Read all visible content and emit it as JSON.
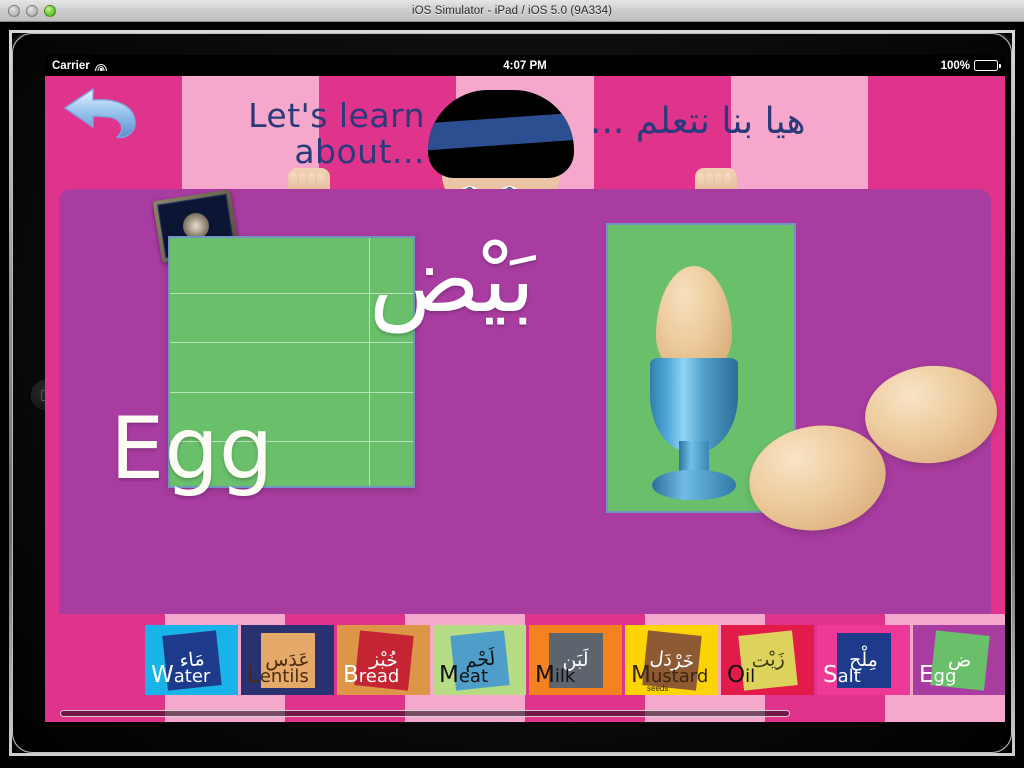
{
  "window": {
    "title": "iOS Simulator - iPad / iOS 5.0 (9A334)",
    "traffic_lights": [
      "close-disabled",
      "minimize-disabled",
      "zoom-green"
    ]
  },
  "status_bar": {
    "carrier": "Carrier",
    "wifi_icon": "wifi-icon",
    "time": "4:07 PM",
    "battery_percent": "100%",
    "battery_icon": "battery-full-icon"
  },
  "header": {
    "back_button_icon": "back-arrow-icon",
    "title_en_line1": "Let's learn",
    "title_en_line2": "about...",
    "title_ar": "هيا بنا نتعلم ...",
    "child_photo_alt": "child-with-beanie-photo",
    "stripe_colors": [
      "#e0338b",
      "#f5a8cc",
      "#e0338b",
      "#f5a8cc",
      "#e0338b",
      "#f5a8cc",
      "#e0338b"
    ]
  },
  "content": {
    "panel_color": "#a83ca0",
    "book_icon": "quran-book-icon",
    "card_bg": "#69bf6a",
    "card_border": "#7492c4",
    "word_arabic": "بَيْض",
    "word_english": "Egg",
    "picture_alt": "egg-in-blue-eggcup-photo"
  },
  "thumbnails": [
    {
      "english": "Water",
      "english_cap": "W",
      "english_rest": "ater",
      "arabic": "مَاء",
      "tile_bg": "#18b4e9",
      "note_bg": "#1e3a8a",
      "note_text": "#ffffff",
      "en_color": "#ffffff"
    },
    {
      "english": "Lentils",
      "english_cap": "L",
      "english_rest": "entils",
      "arabic": "عَدَس",
      "tile_bg": "#2a3170",
      "note_bg": "#e5a96a",
      "note_text": "#4a2b10",
      "en_color": "#4a2b10"
    },
    {
      "english": "Bread",
      "english_cap": "B",
      "english_rest": "read",
      "arabic": "خُبْز",
      "tile_bg": "#dd9548",
      "note_bg": "#c52432",
      "note_text": "#ffffff",
      "en_color": "#ffffff"
    },
    {
      "english": "Meat",
      "english_cap": "M",
      "english_rest": "eat",
      "arabic": "لَحْم",
      "tile_bg": "#b6dc85",
      "note_bg": "#4f9ec9",
      "note_text": "#111111",
      "en_color": "#111111"
    },
    {
      "english": "Milk",
      "english_cap": "M",
      "english_rest": "ilk",
      "arabic": "لَبَن",
      "tile_bg": "#f4821f",
      "note_bg": "#5c646e",
      "note_text": "#ffffff",
      "en_color": "#111111"
    },
    {
      "english": "Mustard",
      "english_cap": "M",
      "english_rest": "ustard",
      "sub": "seeds",
      "arabic": "خَرْدَل",
      "tile_bg": "#fcd406",
      "note_bg": "#8d5a33",
      "note_text": "#ffffff",
      "en_color": "#3a2410"
    },
    {
      "english": "Oil",
      "english_cap": "O",
      "english_rest": "il",
      "arabic": "زَيْت",
      "tile_bg": "#e31b4b",
      "note_bg": "#ddd35c",
      "note_text": "#3a3a10",
      "en_color": "#111111"
    },
    {
      "english": "Salt",
      "english_cap": "S",
      "english_rest": "alt",
      "arabic": "مِلْح",
      "tile_bg": "#ee3a96",
      "note_bg": "#1e3a8a",
      "note_text": "#ffffff",
      "en_color": "#ffffff"
    },
    {
      "english": "Egg",
      "english_cap": "E",
      "english_rest": "gg",
      "arabic": "ض",
      "tile_bg": "#a83ca0",
      "note_bg": "#69bf6a",
      "note_text": "#ffffff",
      "en_color": "#ffffff"
    }
  ],
  "thumb_strip": {
    "stripe_colors": [
      "#e0338b",
      "#f5a8cc",
      "#e0338b",
      "#f5a8cc",
      "#e0338b",
      "#f5a8cc",
      "#e0338b",
      "#f5a8cc"
    ],
    "scroll_indicator": "horizontal-scrollbar"
  }
}
